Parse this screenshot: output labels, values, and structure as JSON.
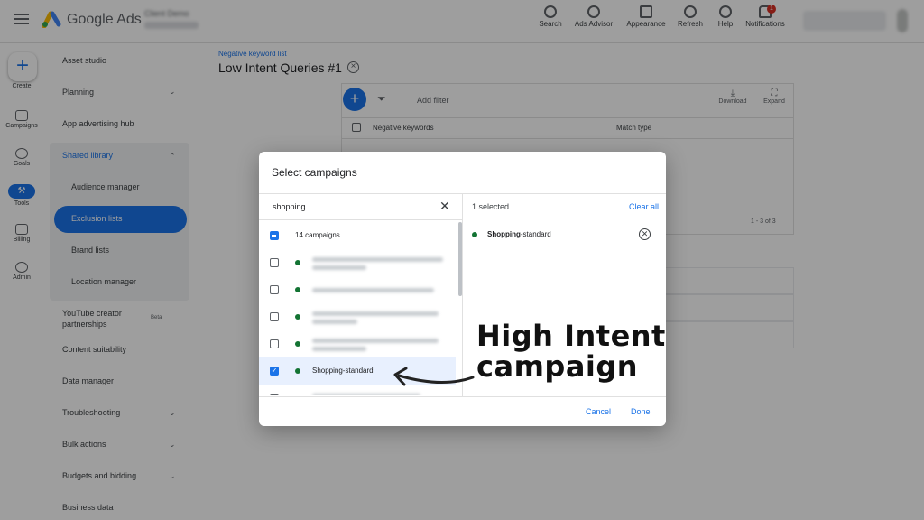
{
  "topbar": {
    "brand": "Google Ads",
    "account_name": "Client Demo",
    "buttons": [
      {
        "label": "Search",
        "icon": "search-icon"
      },
      {
        "label": "Ads Advisor",
        "icon": "advisor-icon"
      },
      {
        "label": "Appearance",
        "icon": "appearance-icon"
      },
      {
        "label": "Refresh",
        "icon": "refresh-icon"
      },
      {
        "label": "Help",
        "icon": "help-icon"
      },
      {
        "label": "Notifications",
        "icon": "bell-icon",
        "badge": "1"
      }
    ]
  },
  "rail": {
    "create": "Create",
    "items": [
      "Campaigns",
      "Goals",
      "Tools",
      "Billing",
      "Admin"
    ]
  },
  "nav": {
    "items": [
      {
        "label": "Asset studio"
      },
      {
        "label": "Planning"
      },
      {
        "label": "App advertising hub"
      },
      {
        "label": "Shared library"
      },
      {
        "label": "Audience manager"
      },
      {
        "label": "Exclusion lists"
      },
      {
        "label": "Brand lists"
      },
      {
        "label": "Location manager"
      },
      {
        "label": "YouTube creator partnerships"
      },
      {
        "label": "Content suitability"
      },
      {
        "label": "Data manager"
      },
      {
        "label": "Troubleshooting"
      },
      {
        "label": "Bulk actions"
      },
      {
        "label": "Budgets and bidding"
      },
      {
        "label": "Business data"
      }
    ],
    "beta_tag": "Beta"
  },
  "page": {
    "breadcrumb": "Negative keyword list",
    "title": "Low Intent Queries #1",
    "add_filter": "Add filter",
    "download": "Download",
    "expand": "Expand",
    "col_keyword": "Negative keywords",
    "col_match": "Match type",
    "pagination": "1 - 3 of 3"
  },
  "dialog": {
    "title": "Select campaigns",
    "search_value": "shopping",
    "selected_count": "1 selected",
    "clear_all": "Clear all",
    "all_label": "14 campaigns",
    "selected_campaign_label": "Shopping-standard",
    "selected_item_bold": "Shopping",
    "selected_item_rest": "-standard",
    "cancel": "Cancel",
    "done": "Done"
  },
  "annotation": {
    "line1": "High Intent",
    "line2": "campaign"
  },
  "colors": {
    "accent": "#1a73e8",
    "status_green": "#137333"
  }
}
